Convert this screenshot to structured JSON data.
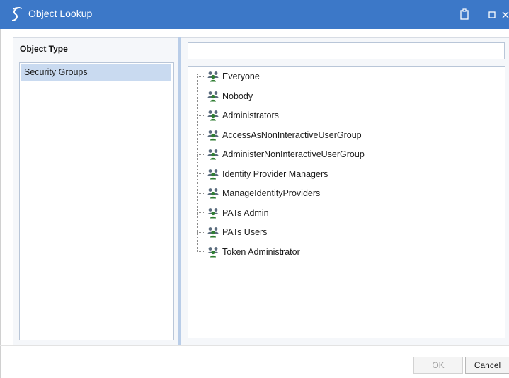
{
  "window": {
    "title": "Object Lookup",
    "titlebar_color": "#3c78c8",
    "icons": [
      "app-logo-icon",
      "clipboard-icon",
      "maximize-icon",
      "close-icon"
    ]
  },
  "object_type": {
    "header": "Object Type",
    "items": [
      {
        "label": "Security Groups",
        "selected": true
      }
    ]
  },
  "search": {
    "value": "",
    "placeholder": ""
  },
  "groups": [
    {
      "label": "Everyone",
      "icon": "security-group-icon"
    },
    {
      "label": "Nobody",
      "icon": "security-group-icon"
    },
    {
      "label": "Administrators",
      "icon": "security-group-icon"
    },
    {
      "label": "AccessAsNonInteractiveUserGroup",
      "icon": "security-group-icon"
    },
    {
      "label": "AdministerNonInteractiveUserGroup",
      "icon": "security-group-icon"
    },
    {
      "label": "Identity Provider Managers",
      "icon": "security-group-icon"
    },
    {
      "label": "ManageIdentityProviders",
      "icon": "security-group-icon"
    },
    {
      "label": "PATs Admin",
      "icon": "security-group-icon"
    },
    {
      "label": "PATs Users",
      "icon": "security-group-icon"
    },
    {
      "label": "Token Administrator",
      "icon": "security-group-icon"
    }
  ],
  "buttons": {
    "ok_label": "OK",
    "ok_enabled": false,
    "cancel_label": "Cancel"
  },
  "colors": {
    "selection": "#c9daf0",
    "splitter": "#b9cde8"
  }
}
